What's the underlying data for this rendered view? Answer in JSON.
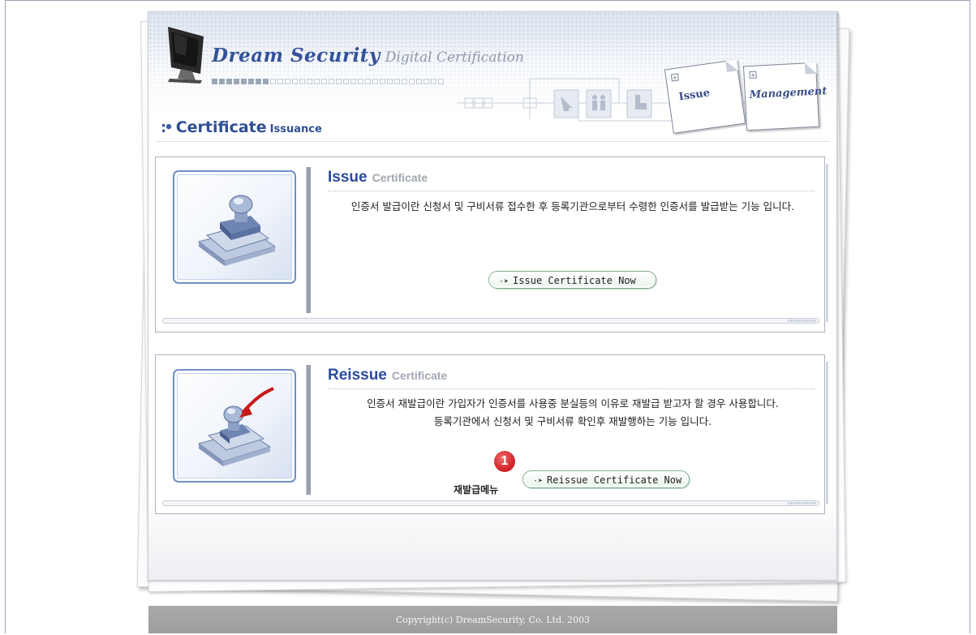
{
  "header": {
    "brand_name": "Dream Security",
    "brand_sub": "Digital Certification",
    "page_heading_main": "Certificate",
    "page_heading_sub": "Issuance",
    "tabs": [
      {
        "label": "Issue"
      },
      {
        "label": "Management"
      }
    ]
  },
  "panels": {
    "issue": {
      "title": "Issue",
      "title_sub": "Certificate",
      "description": "인증서 발급이란 신청서 및 구비서류 접수한 후 등록기관으로부터 수령한 인증서를 발급받는 기능 입니다.",
      "button_label": "Issue Certificate Now",
      "icon": "stamp-icon"
    },
    "reissue": {
      "title": "Reissue",
      "title_sub": "Certificate",
      "description_line1": "인증서 재발급이란 가입자가 인증서를 사용중 분실등의 이유로 재발급 받고자 할 경우 사용합니다.",
      "description_line2": "등록기관에서 신청서 및 구비서류 확인후 재발행하는 기능 입니다.",
      "button_label": "Reissue Certificate Now",
      "icon": "stamp-arrow-icon",
      "marker_number": "1",
      "marker_label": "재발급메뉴"
    }
  },
  "footer": {
    "copyright": "Copyright(c) DreamSecurity, Co. Ltd. 2003"
  },
  "colors": {
    "brand": "#34529a",
    "heading": "#2f4f94",
    "button_border": "#7fae8c",
    "marker": "#d4262b",
    "footer_bg": "#a2a3a5"
  }
}
